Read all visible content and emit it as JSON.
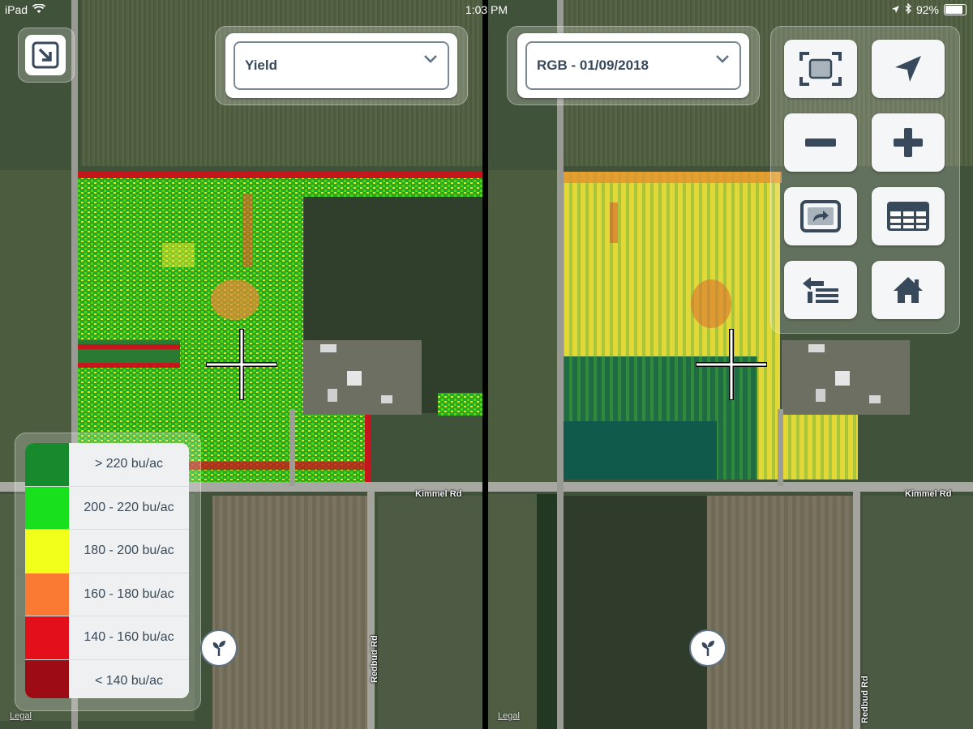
{
  "status_bar": {
    "device": "iPad",
    "time": "1:03 PM",
    "battery": "92%"
  },
  "left_pane": {
    "layer_select": {
      "value": "Yield"
    },
    "legend": {
      "items": [
        {
          "label": "> 220 bu/ac",
          "color": "#188a2e"
        },
        {
          "label": "200 - 220 bu/ac",
          "color": "#19e01c"
        },
        {
          "label": "180 - 200 bu/ac",
          "color": "#f2ff1a"
        },
        {
          "label": "160 - 180 bu/ac",
          "color": "#fb7a33"
        },
        {
          "label": "140 - 160 bu/ac",
          "color": "#e3101c"
        },
        {
          "label": "< 140 bu/ac",
          "color": "#9d0c14"
        }
      ]
    },
    "road_label_h": "Kimmel Rd",
    "road_label_v": "Redbud Rd",
    "legal": "Legal"
  },
  "right_pane": {
    "layer_select": {
      "value": "RGB - 01/09/2018"
    },
    "road_label_h": "Kimmel Rd",
    "road_label_v": "Redbud Rd",
    "legal": "Legal"
  },
  "toolbar": [
    {
      "icon": "fit-to-screen-icon"
    },
    {
      "icon": "location-arrow-icon"
    },
    {
      "icon": "zoom-out-icon"
    },
    {
      "icon": "zoom-in-icon"
    },
    {
      "icon": "share-screen-icon"
    },
    {
      "icon": "table-icon"
    },
    {
      "icon": "layer-list-icon"
    },
    {
      "icon": "home-icon"
    }
  ],
  "colors": {
    "accent": "#37495a",
    "ui_border": "#7a8893"
  }
}
